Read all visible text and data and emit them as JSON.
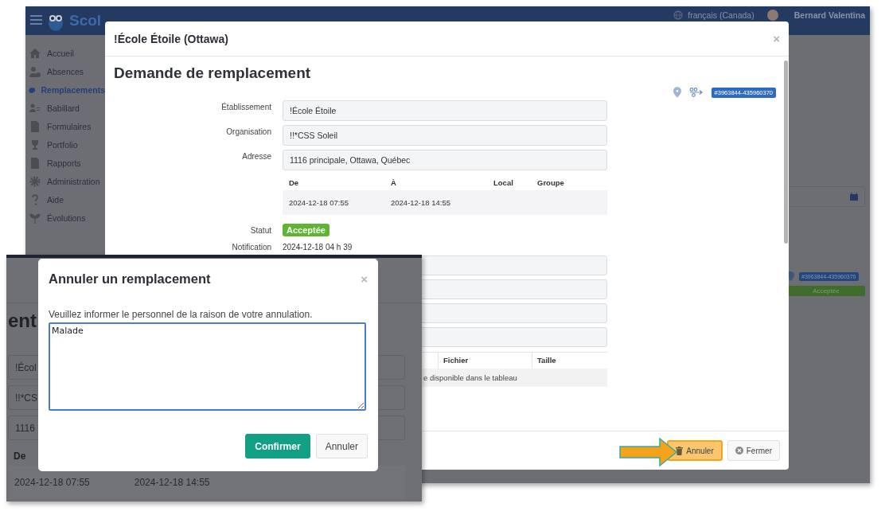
{
  "app": {
    "brand": "Scol",
    "language": "français (Canada)",
    "user": "Bernard Valentina",
    "sidebar": {
      "items": [
        {
          "label": "Accueil",
          "selected": false
        },
        {
          "label": "Absences",
          "selected": false
        },
        {
          "label": "Remplacements",
          "selected": true
        },
        {
          "label": "Babillard",
          "selected": false
        },
        {
          "label": "Formulaires",
          "selected": false
        },
        {
          "label": "Portfolio",
          "selected": false
        },
        {
          "label": "Rapports",
          "selected": false
        },
        {
          "label": "Administration",
          "selected": false
        },
        {
          "label": "Aide",
          "selected": false
        },
        {
          "label": "Évolutions",
          "selected": false
        }
      ]
    },
    "background": {
      "reference": "#3963844-435960370",
      "status": "Acceptée"
    }
  },
  "dialog": {
    "title": "!École Étoile (Ottawa)",
    "close": "×",
    "heading": "Demande de remplacement",
    "reference": "#3963844-435960370",
    "fields": [
      {
        "label": "Établissement",
        "value": "!École Étoile"
      },
      {
        "label": "Organisation",
        "value": "!!*CSS Soleil"
      },
      {
        "label": "Adresse",
        "value": "1116 principale, Ottawa, Québec"
      }
    ],
    "schedule": {
      "columns": [
        "De",
        "À",
        "Local",
        "Groupe"
      ],
      "rows": [
        [
          "2024-12-18 07:55",
          "2024-12-18 14:55"
        ]
      ]
    },
    "status": {
      "label": "Statut",
      "value": "Acceptée"
    },
    "notification": {
      "label": "Notification",
      "value": "2024-12-18 04 h 39"
    },
    "more_fields": [
      {
        "kind": "text"
      },
      {
        "kind": "text"
      },
      {
        "kind": "text"
      },
      {
        "kind": "text"
      }
    ],
    "files": {
      "columns": [
        "Fichier",
        "Taille"
      ],
      "message": "e disponible dans le tableau"
    },
    "buttons": [
      {
        "label": "Annuler",
        "kind": "cancel",
        "highlighted": true
      },
      {
        "label": "Fermer",
        "kind": "close",
        "highlighted": false
      }
    ]
  },
  "inset": {
    "heading": "ent",
    "fields": [
      "!Écol",
      "!!*CS",
      "1116"
    ],
    "schedule": {
      "column": "De",
      "values": [
        "2024-12-18 07:55",
        "2024-12-18 14:55"
      ]
    },
    "dialog": {
      "title": "Annuler un remplacement",
      "close": "×",
      "prompt": "Veuillez informer le personnel de la raison de votre annulation.",
      "reason": "Malade",
      "buttons": [
        {
          "label": "Confirmer",
          "kind": "primary"
        },
        {
          "label": "Annuler",
          "kind": "secondary"
        }
      ]
    }
  }
}
